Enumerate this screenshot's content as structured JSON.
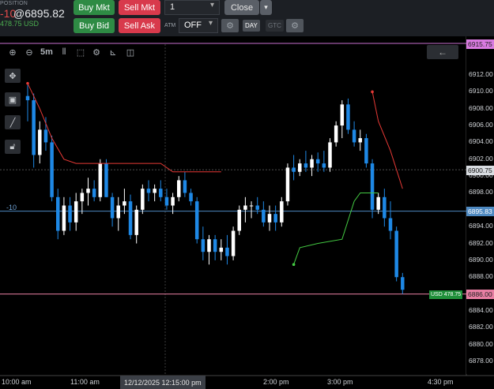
{
  "position": {
    "label": "POSITION",
    "qty": "-10",
    "price": "@6895.82",
    "pnl": "478.75 USD"
  },
  "buttons": {
    "buy_mkt": "Buy Mkt",
    "sell_mkt": "Sell Mkt",
    "buy_bid": "Buy Bid",
    "sell_ask": "Sell Ask",
    "close": "Close"
  },
  "order_qty": "1",
  "atm": {
    "label": "ATM",
    "value": "OFF"
  },
  "tif": {
    "day": "DAY",
    "gtc": "GTC"
  },
  "chart_toolbar": {
    "bar_type": "5m"
  },
  "icons": {
    "zoom_in": "zoom-in-icon",
    "zoom_out": "zoom-out-icon",
    "bars": "bars-icon",
    "select": "select-icon",
    "settings": "gear-icon",
    "studies": "studies-icon",
    "layout": "layout-icon",
    "back": "arrow-left-icon",
    "crosshair": "crosshair-icon",
    "tool": "tool-icon",
    "line": "line-icon",
    "lock": "lock-icon"
  },
  "colors": {
    "up": "#1e88e5",
    "down": "#1e88e5",
    "stop_line": "#e53935",
    "target_line": "#43c942",
    "position_line": "#4e89c1",
    "pnl_green": "#4caf50"
  },
  "position_line_label": "-10",
  "usd_badge": "USD 478.75",
  "y_labels": [
    "6912.00",
    "6910.00",
    "6908.00",
    "6906.00",
    "6904.00",
    "6902.00",
    "6900.00",
    "6898.00",
    "6896.00",
    "6894.00",
    "6892.00",
    "6890.00",
    "6888.00",
    "6886.00",
    "6884.00",
    "6882.00",
    "6880.00",
    "6878.00"
  ],
  "badges": {
    "top": "6915.75",
    "current": "6900.75",
    "position": "6895.83",
    "last": "6886.00"
  },
  "x_labels": [
    "10:00 am",
    "11:00 am",
    "2:00 pm",
    "3:00 pm",
    "4:30 pm"
  ],
  "x_cursor": "12/12/2025 12:15:00 pm",
  "chart_data": {
    "type": "candlestick",
    "ylim": [
      6876.5,
      6916.5
    ],
    "y_labels": [
      6912,
      6910,
      6908,
      6906,
      6904,
      6902,
      6900,
      6898,
      6896,
      6894,
      6892,
      6890,
      6888,
      6886,
      6884,
      6882,
      6880,
      6878
    ],
    "x_labels": [
      "10:00 am",
      "11:00 am",
      "2:00 pm",
      "3:00 pm",
      "4:30 pm"
    ],
    "horizontal_lines": [
      {
        "name": "top",
        "value": 6915.75
      },
      {
        "name": "current",
        "value": 6900.75
      },
      {
        "name": "position",
        "value": 6895.83
      },
      {
        "name": "last",
        "value": 6886.0
      }
    ],
    "candles": [
      [
        6909.5,
        6910.8,
        6906.5,
        6909.0
      ],
      [
        6909.0,
        6909.8,
        6901.0,
        6902.5
      ],
      [
        6902.5,
        6906.5,
        6901.5,
        6905.5
      ],
      [
        6905.5,
        6907.0,
        6903.0,
        6904.0
      ],
      [
        6904.0,
        6904.8,
        6897.0,
        6897.5
      ],
      [
        6897.5,
        6898.5,
        6892.5,
        6893.5
      ],
      [
        6893.5,
        6897.5,
        6893.0,
        6896.5
      ],
      [
        6896.5,
        6897.5,
        6893.5,
        6894.5
      ],
      [
        6894.5,
        6898.0,
        6893.5,
        6897.0
      ],
      [
        6897.0,
        6898.5,
        6895.5,
        6898.0
      ],
      [
        6898.0,
        6899.8,
        6896.5,
        6898.5
      ],
      [
        6898.5,
        6899.5,
        6897.0,
        6897.5
      ],
      [
        6897.5,
        6902.0,
        6897.0,
        6901.5
      ],
      [
        6901.5,
        6902.0,
        6897.5,
        6897.5
      ],
      [
        6897.5,
        6898.0,
        6894.0,
        6895.0
      ],
      [
        6895.0,
        6897.5,
        6893.5,
        6896.5
      ],
      [
        6896.5,
        6898.5,
        6895.5,
        6897.0
      ],
      [
        6897.0,
        6897.8,
        6892.5,
        6893.0
      ],
      [
        6893.0,
        6896.5,
        6892.0,
        6896.0
      ],
      [
        6896.0,
        6899.0,
        6895.5,
        6898.5
      ],
      [
        6898.5,
        6899.5,
        6897.0,
        6898.0
      ],
      [
        6898.0,
        6899.0,
        6897.0,
        6898.5
      ],
      [
        6898.5,
        6899.5,
        6897.0,
        6897.5
      ],
      [
        6897.5,
        6898.5,
        6896.0,
        6896.5
      ],
      [
        6896.5,
        6898.0,
        6895.5,
        6897.5
      ],
      [
        6897.5,
        6900.0,
        6897.0,
        6899.5
      ],
      [
        6899.5,
        6900.5,
        6897.5,
        6898.0
      ],
      [
        6898.0,
        6898.5,
        6896.5,
        6897.0
      ],
      [
        6897.0,
        6897.5,
        6892.0,
        6892.5
      ],
      [
        6892.5,
        6894.0,
        6890.0,
        6891.0
      ],
      [
        6891.0,
        6893.0,
        6889.5,
        6892.5
      ],
      [
        6892.5,
        6893.0,
        6890.0,
        6891.0
      ],
      [
        6891.0,
        6892.5,
        6890.0,
        6891.5
      ],
      [
        6891.5,
        6893.0,
        6889.5,
        6890.5
      ],
      [
        6890.5,
        6894.0,
        6890.0,
        6893.5
      ],
      [
        6893.5,
        6896.5,
        6893.0,
        6896.0
      ],
      [
        6896.0,
        6897.5,
        6894.5,
        6896.5
      ],
      [
        6896.5,
        6897.0,
        6895.0,
        6896.5
      ],
      [
        6896.5,
        6897.5,
        6895.5,
        6896.0
      ],
      [
        6896.0,
        6897.0,
        6894.0,
        6894.5
      ],
      [
        6894.5,
        6896.5,
        6893.5,
        6895.5
      ],
      [
        6895.5,
        6896.5,
        6893.5,
        6894.5
      ],
      [
        6894.5,
        6897.5,
        6894.0,
        6897.0
      ],
      [
        6897.0,
        6901.5,
        6896.5,
        6901.0
      ],
      [
        6901.0,
        6902.5,
        6899.5,
        6900.5
      ],
      [
        6900.5,
        6902.0,
        6900.0,
        6901.5
      ],
      [
        6901.5,
        6903.0,
        6900.5,
        6901.0
      ],
      [
        6901.0,
        6902.5,
        6900.0,
        6902.0
      ],
      [
        6902.0,
        6902.8,
        6900.5,
        6901.5
      ],
      [
        6901.5,
        6903.0,
        6900.5,
        6901.0
      ],
      [
        6901.0,
        6904.5,
        6900.5,
        6904.0
      ],
      [
        6904.0,
        6906.5,
        6903.5,
        6906.0
      ],
      [
        6906.0,
        6909.0,
        6904.5,
        6908.5
      ],
      [
        6908.5,
        6909.2,
        6905.0,
        6905.5
      ],
      [
        6905.5,
        6906.5,
        6903.5,
        6904.0
      ],
      [
        6904.0,
        6905.5,
        6903.0,
        6904.5
      ],
      [
        6904.5,
        6905.0,
        6901.0,
        6901.5
      ],
      [
        6901.5,
        6902.0,
        6895.0,
        6896.0
      ],
      [
        6896.0,
        6898.0,
        6895.5,
        6897.5
      ],
      [
        6897.5,
        6898.5,
        6894.0,
        6895.0
      ],
      [
        6895.0,
        6897.0,
        6892.5,
        6893.5
      ],
      [
        6893.5,
        6894.0,
        6887.5,
        6888.0
      ],
      [
        6888.0,
        6888.5,
        6886.0,
        6886.5
      ]
    ],
    "stop_line": [
      [
        0,
        6911.0
      ],
      [
        2,
        6908.0
      ],
      [
        4,
        6904.5
      ],
      [
        6,
        6902.0
      ],
      [
        8,
        6901.5
      ],
      [
        22,
        6901.5
      ],
      [
        24,
        6900.5
      ],
      [
        32,
        6900.5
      ],
      [
        57,
        6910.0
      ],
      [
        58,
        6906.5
      ],
      [
        60,
        6903.0
      ],
      [
        62,
        6898.5
      ]
    ],
    "target_line": [
      [
        44,
        6889.5
      ],
      [
        45,
        6891.5
      ],
      [
        48,
        6892.0
      ],
      [
        52,
        6892.5
      ],
      [
        54,
        6897.0
      ],
      [
        55,
        6898.0
      ],
      [
        58,
        6898.0
      ]
    ]
  }
}
